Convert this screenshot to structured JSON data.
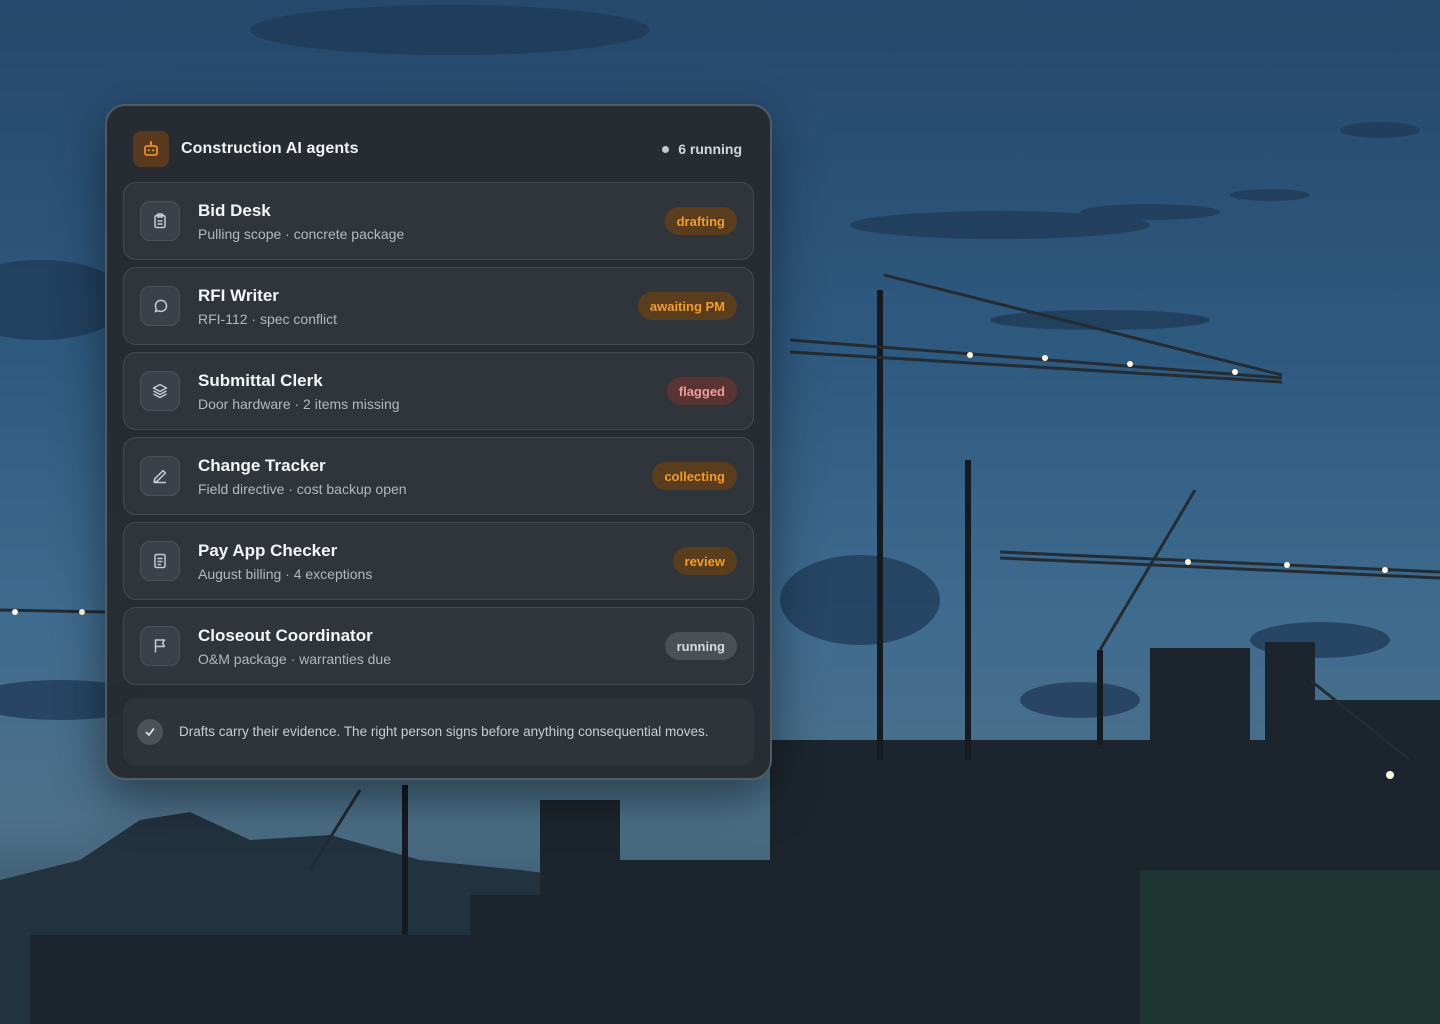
{
  "panel": {
    "title": "Construction AI agents",
    "status": "6 running",
    "icon": "robot-icon"
  },
  "agents": [
    {
      "name": "Bid Desk",
      "detail": "Pulling scope · concrete package",
      "status": "drafting",
      "status_tone": "amber",
      "icon": "clipboard-icon"
    },
    {
      "name": "RFI Writer",
      "detail": "RFI-112 · spec conflict",
      "status": "awaiting PM",
      "status_tone": "amber",
      "icon": "chat-bubble-icon"
    },
    {
      "name": "Submittal Clerk",
      "detail": "Door hardware · 2 items missing",
      "status": "flagged",
      "status_tone": "red",
      "icon": "layers-icon"
    },
    {
      "name": "Change Tracker",
      "detail": "Field directive · cost backup open",
      "status": "collecting",
      "status_tone": "amber",
      "icon": "pencil-icon"
    },
    {
      "name": "Pay App Checker",
      "detail": "August billing · 4 exceptions",
      "status": "review",
      "status_tone": "amber",
      "icon": "document-icon"
    },
    {
      "name": "Closeout Coordinator",
      "detail": "O&M package · warranties due",
      "status": "running",
      "status_tone": "neutral",
      "icon": "flag-icon"
    }
  ],
  "footer": {
    "note": "Drafts carry their evidence. The right person signs before anything consequential moves.",
    "icon": "check-icon"
  },
  "colors": {
    "accent_amber": "#f29b2f",
    "flag_red": "#f09a9a",
    "panel_bg": "#262b30"
  }
}
